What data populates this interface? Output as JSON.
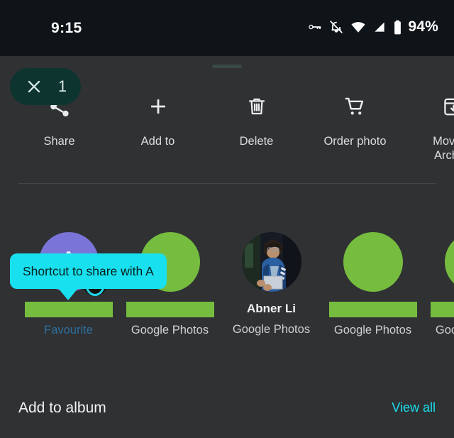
{
  "status_bar": {
    "time": "9:15",
    "battery_percent": "94%",
    "icons": [
      "vpn-key-icon",
      "notifications-muted-icon",
      "wifi-icon",
      "cellular-signal-icon",
      "battery-icon"
    ]
  },
  "sheet": {
    "drag_handle": "drag-handle",
    "selection_chip": {
      "close_icon": "close-icon",
      "count": "1"
    },
    "actions": [
      {
        "icon": "share-icon",
        "label": "Share"
      },
      {
        "icon": "add-icon",
        "label": "Add to"
      },
      {
        "icon": "delete-icon",
        "label": "Delete"
      },
      {
        "icon": "cart-icon",
        "label": "Order photo"
      },
      {
        "icon": "archive-icon",
        "label": "Move to\nArchive"
      }
    ],
    "tooltip": {
      "text": "Shortcut to share with A",
      "background": "#19e0ee"
    },
    "people": [
      {
        "avatar_type": "letter",
        "avatar_letter": "A",
        "avatar_color": "#7a74d8",
        "badge": "favourite-heart-icon",
        "name_placeholder": true,
        "name": "",
        "subtitle": "Favourite",
        "subtitle_color": "#2f6f9c"
      },
      {
        "avatar_type": "placeholder",
        "avatar_color": "#76bc3f",
        "name_placeholder": true,
        "name": "",
        "subtitle": "Google Photos"
      },
      {
        "avatar_type": "photo",
        "name_placeholder": false,
        "name": "Abner Li",
        "subtitle": "Google Photos"
      },
      {
        "avatar_type": "placeholder",
        "avatar_color": "#76bc3f",
        "name_placeholder": true,
        "name": "",
        "subtitle": "Google Photos"
      },
      {
        "avatar_type": "placeholder",
        "avatar_color": "#76bc3f",
        "name_placeholder": true,
        "name": "",
        "subtitle": "Google Photos"
      }
    ],
    "bottom": {
      "title": "Add to album",
      "link": "View all"
    }
  },
  "colors": {
    "sheet_background": "#2f3133",
    "status_background": "#0e1418",
    "accent_cyan": "#19e0ee",
    "chip_green": "#0e3430",
    "placeholder_green": "#76bc3f"
  }
}
